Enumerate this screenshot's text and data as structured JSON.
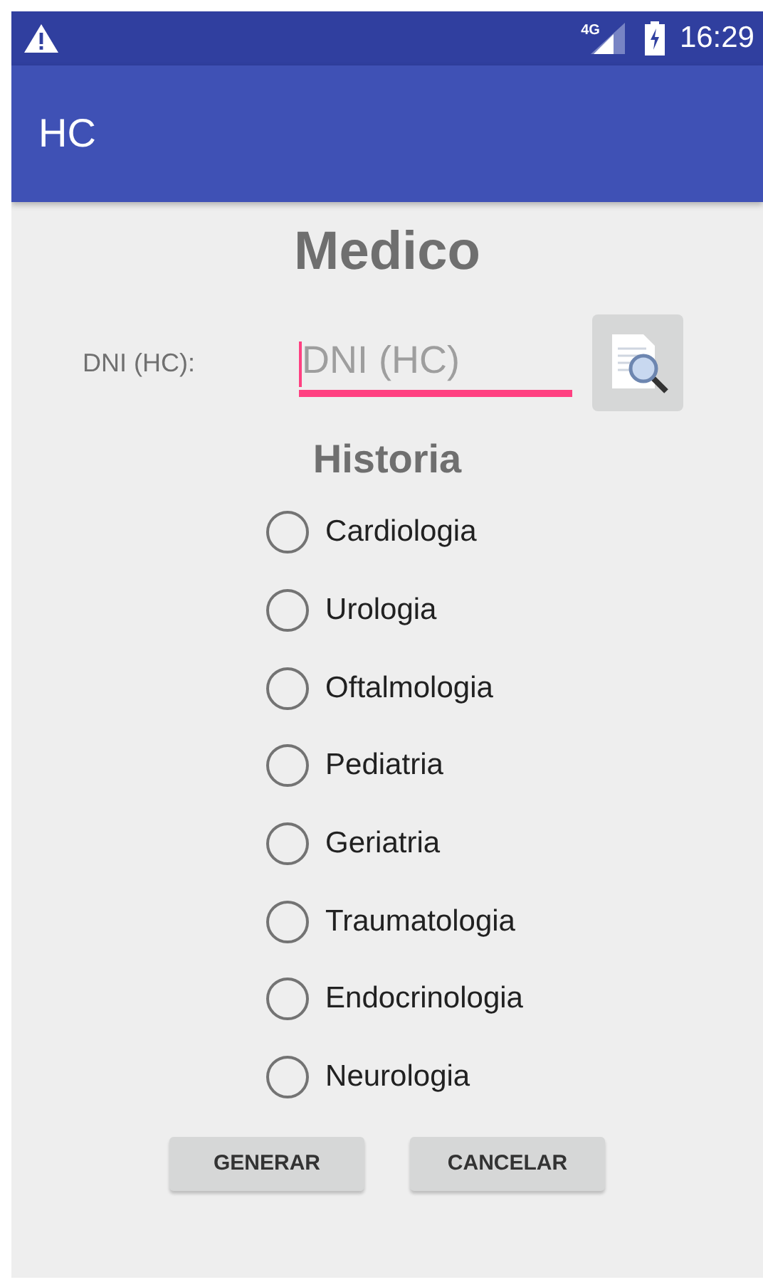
{
  "status_bar": {
    "network": "4G",
    "time": "16:29"
  },
  "app_bar": {
    "title": "HC"
  },
  "heading": "Medico",
  "dni": {
    "label": "DNI (HC):",
    "placeholder": "DNI (HC)",
    "focused": true
  },
  "section": "Historia",
  "options": [
    {
      "label": "Cardiologia",
      "selected": false
    },
    {
      "label": "Urologia",
      "selected": false
    },
    {
      "label": "Oftalmologia",
      "selected": false
    },
    {
      "label": "Pediatria",
      "selected": false
    },
    {
      "label": "Geriatria",
      "selected": false
    },
    {
      "label": "Traumatologia",
      "selected": false
    },
    {
      "label": "Endocrinologia",
      "selected": false
    },
    {
      "label": "Neurologia",
      "selected": false
    }
  ],
  "buttons": [
    "GENERAR",
    "CANCELAR"
  ]
}
